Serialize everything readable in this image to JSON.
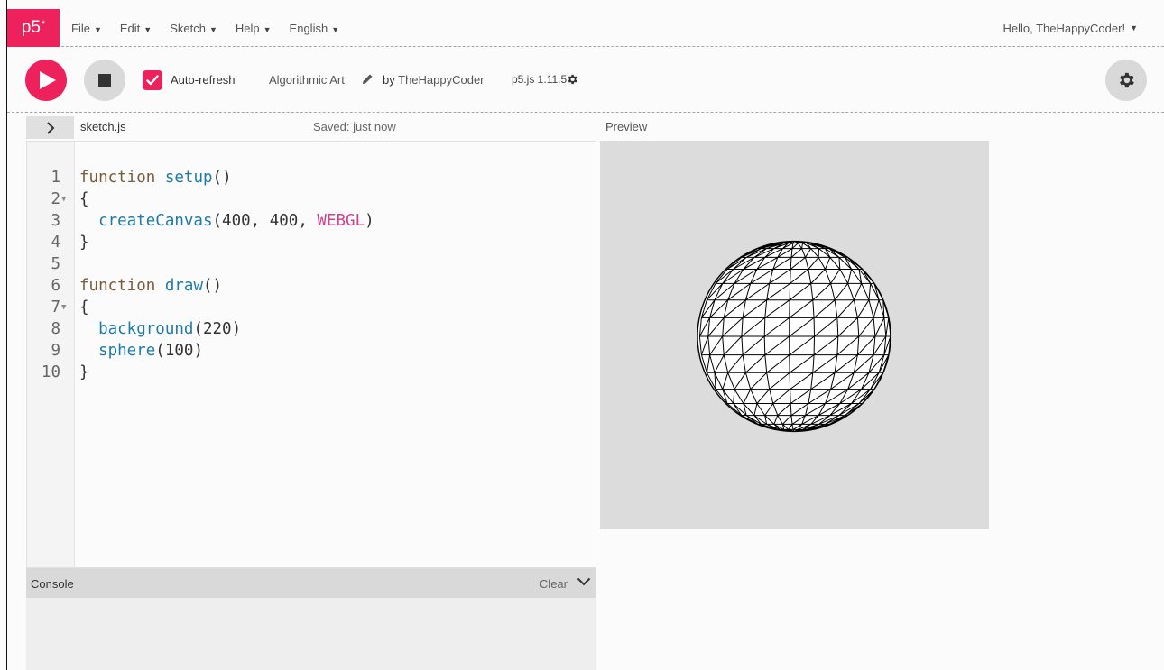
{
  "nav": {
    "logo": "p5",
    "logo_sup": "*",
    "menu": [
      "File",
      "Edit",
      "Sketch",
      "Help",
      "English"
    ],
    "user": "Hello, TheHappyCoder!"
  },
  "toolbar": {
    "auto_refresh_label": "Auto-refresh",
    "auto_refresh_checked": true,
    "sketch_name": "Algorithmic Art",
    "by_label": "by",
    "author": "TheHappyCoder",
    "version": "p5.js 1.11.5"
  },
  "editor": {
    "filename": "sketch.js",
    "saved_status": "Saved: just now",
    "lines": [
      {
        "n": "1",
        "fold": false
      },
      {
        "n": "2",
        "fold": true
      },
      {
        "n": "3",
        "fold": false
      },
      {
        "n": "4",
        "fold": false
      },
      {
        "n": "5",
        "fold": false
      },
      {
        "n": "6",
        "fold": false
      },
      {
        "n": "7",
        "fold": true
      },
      {
        "n": "8",
        "fold": false
      },
      {
        "n": "9",
        "fold": false
      },
      {
        "n": "10",
        "fold": false
      }
    ],
    "code": {
      "l1_kw": "function",
      "l1_fn": "setup",
      "l1_rest": "()",
      "l2": "{",
      "l3_fn": "createCanvas",
      "l3_args": "(400, 400, ",
      "l3_const": "WEBGL",
      "l3_end": ")",
      "l4": "}",
      "l5": "",
      "l6_kw": "function",
      "l6_fn": "draw",
      "l6_rest": "()",
      "l7": "{",
      "l8_fn": "background",
      "l8_args": "(220)",
      "l9_fn": "sphere",
      "l9_args": "(100)",
      "l10": "}"
    }
  },
  "console": {
    "title": "Console",
    "clear_label": "Clear"
  },
  "preview": {
    "label": "Preview",
    "background_color": "#dcdcdc"
  },
  "colors": {
    "accent": "#ed225d",
    "keyword": "#7a5a3a",
    "function": "#1f7aa5",
    "constant": "#d13f8d"
  }
}
